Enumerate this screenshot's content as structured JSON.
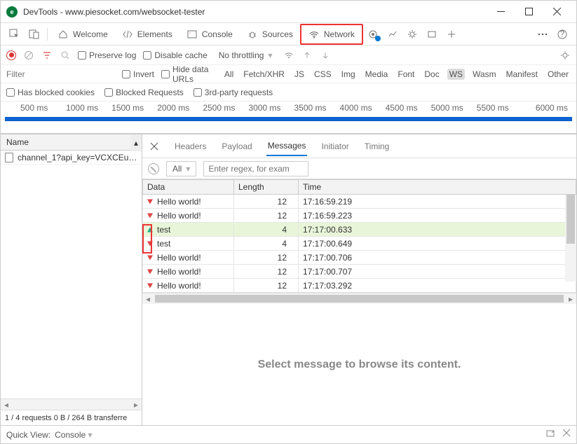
{
  "window": {
    "title": "DevTools - www.piesocket.com/websocket-tester"
  },
  "tabs": {
    "welcome": "Welcome",
    "elements": "Elements",
    "console": "Console",
    "sources": "Sources",
    "network": "Network"
  },
  "netbar": {
    "preserve_log": "Preserve log",
    "disable_cache": "Disable cache",
    "throttling": "No throttling"
  },
  "filter": {
    "placeholder": "Filter",
    "invert": "Invert",
    "hide_data_urls": "Hide data URLs",
    "types": [
      "All",
      "Fetch/XHR",
      "JS",
      "CSS",
      "Img",
      "Media",
      "Font",
      "Doc",
      "WS",
      "Wasm",
      "Manifest",
      "Other"
    ]
  },
  "blocked": {
    "has_blocked_cookies": "Has blocked cookies",
    "blocked_requests": "Blocked Requests",
    "third_party": "3rd-party requests"
  },
  "timeline_labels": [
    "500 ms",
    "1000 ms",
    "1500 ms",
    "2000 ms",
    "2500 ms",
    "3000 ms",
    "3500 ms",
    "4000 ms",
    "4500 ms",
    "5000 ms",
    "5500 ms",
    "6000 ms"
  ],
  "requests": {
    "header": "Name",
    "items": [
      "channel_1?api_key=VCXCEu…"
    ],
    "status": "1 / 4 requests   0 B / 264 B transferre"
  },
  "msg": {
    "tabs": {
      "headers": "Headers",
      "payload": "Payload",
      "messages": "Messages",
      "initiator": "Initiator",
      "timing": "Timing"
    },
    "filter_all": "All",
    "filter_placeholder": "Enter regex, for exam",
    "cols": {
      "data": "Data",
      "length": "Length",
      "time": "Time"
    },
    "rows": [
      {
        "dir": "down",
        "data": "Hello world!",
        "len": "12",
        "time": "17:16:59.219"
      },
      {
        "dir": "down",
        "data": "Hello world!",
        "len": "12",
        "time": "17:16:59.223"
      },
      {
        "dir": "up",
        "data": "test",
        "len": "4",
        "time": "17:17:00.633",
        "green": true
      },
      {
        "dir": "down",
        "data": "test",
        "len": "4",
        "time": "17:17:00.649"
      },
      {
        "dir": "down",
        "data": "Hello world!",
        "len": "12",
        "time": "17:17:00.706"
      },
      {
        "dir": "down",
        "data": "Hello world!",
        "len": "12",
        "time": "17:17:00.707"
      },
      {
        "dir": "down",
        "data": "Hello world!",
        "len": "12",
        "time": "17:17:03.292"
      }
    ],
    "empty": "Select message to browse its content."
  },
  "bottombar": {
    "quickview": "Quick View:",
    "console": "Console"
  }
}
